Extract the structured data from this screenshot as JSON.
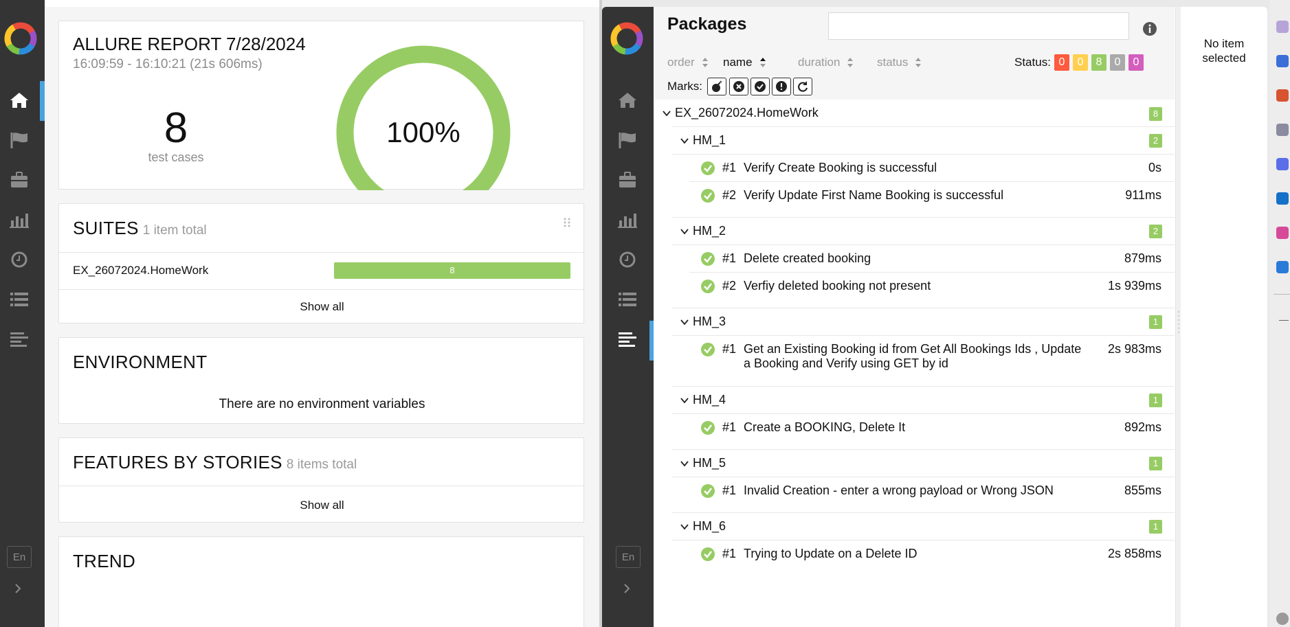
{
  "left": {
    "report": {
      "title": "ALLURE REPORT 7/28/2024",
      "time": "16:09:59 - 16:10:21 (21s 606ms)",
      "count": "8",
      "count_label": "test cases",
      "percent": "100%",
      "pass_ratio": 1.0
    },
    "suites": {
      "title": "SUITES",
      "subtitle": "1 item total",
      "items": [
        {
          "name": "EX_26072024.HomeWork",
          "count": "8"
        }
      ],
      "show_all": "Show all"
    },
    "environment": {
      "title": "ENVIRONMENT",
      "message": "There are no environment variables"
    },
    "features": {
      "title": "FEATURES BY STORIES",
      "subtitle": "8 items total",
      "show_all": "Show all"
    },
    "trend": {
      "title": "TREND"
    },
    "lang": "En"
  },
  "right": {
    "packages": {
      "title": "Packages",
      "search_value": "",
      "sort": [
        {
          "label": "order"
        },
        {
          "label": "name"
        },
        {
          "label": "duration"
        },
        {
          "label": "status"
        }
      ],
      "status_label": "Status:",
      "status_counts": [
        {
          "value": "0",
          "color": "#fd5a3e"
        },
        {
          "value": "0",
          "color": "#ffd050"
        },
        {
          "value": "8",
          "color": "#97cc64"
        },
        {
          "value": "0",
          "color": "#aaaaaa"
        },
        {
          "value": "0",
          "color": "#d35ebe"
        }
      ],
      "marks_label": "Marks:",
      "marks": [
        "bomb-icon",
        "x-circle-icon",
        "check-circle-icon",
        "exclamation-circle-icon",
        "refresh-icon"
      ],
      "root": {
        "name": "EX_26072024.HomeWork",
        "count": "8"
      },
      "groups": [
        {
          "name": "HM_1",
          "count": "2",
          "tests": [
            {
              "num": "#1",
              "name": "Verify Create Booking is successful",
              "duration": "0s"
            },
            {
              "num": "#2",
              "name": "Verify Update First Name Booking is successful",
              "duration": "911ms"
            }
          ]
        },
        {
          "name": "HM_2",
          "count": "2",
          "tests": [
            {
              "num": "#1",
              "name": "Delete created booking",
              "duration": "879ms"
            },
            {
              "num": "#2",
              "name": "Verfiy deleted booking not present",
              "duration": "1s 939ms"
            }
          ]
        },
        {
          "name": "HM_3",
          "count": "1",
          "tests": [
            {
              "num": "#1",
              "name": "Get an Existing Booking id from Get All Bookings Ids , Update a Booking and Verify using GET by id",
              "duration": "2s 983ms"
            }
          ]
        },
        {
          "name": "HM_4",
          "count": "1",
          "tests": [
            {
              "num": "#1",
              "name": "Create a BOOKING, Delete It",
              "duration": "892ms"
            }
          ]
        },
        {
          "name": "HM_5",
          "count": "1",
          "tests": [
            {
              "num": "#1",
              "name": "Invalid Creation - enter a wrong payload or Wrong JSON",
              "duration": "855ms"
            }
          ]
        },
        {
          "name": "HM_6",
          "count": "1",
          "tests": [
            {
              "num": "#1",
              "name": "Trying to Update on a Delete ID",
              "duration": "2s 858ms"
            }
          ]
        }
      ]
    },
    "detail": {
      "empty": "No item selected"
    },
    "lang": "En"
  },
  "colors": {
    "passed": "#97cc64",
    "sidebar": "#343434",
    "active": "#4aa3df"
  }
}
